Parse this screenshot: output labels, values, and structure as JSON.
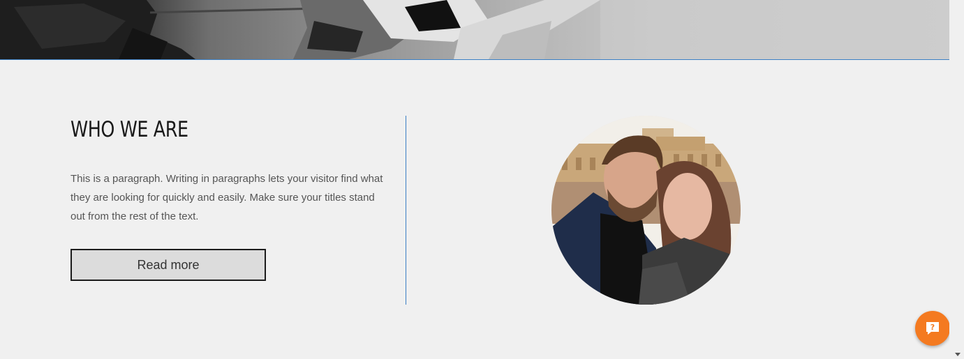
{
  "section": {
    "title": "WHO WE ARE",
    "paragraph": "This is a paragraph. Writing in paragraphs lets your visitor find what they are looking for quickly and easily. Make sure your titles stand out from the rest of the text.",
    "button_label": "Read more"
  },
  "help_button": {
    "icon": "question-chat-icon",
    "symbol": "?"
  },
  "colors": {
    "accent_line": "#3b7fc4",
    "help_button": "#f47a20",
    "background": "#f0f0f0"
  }
}
